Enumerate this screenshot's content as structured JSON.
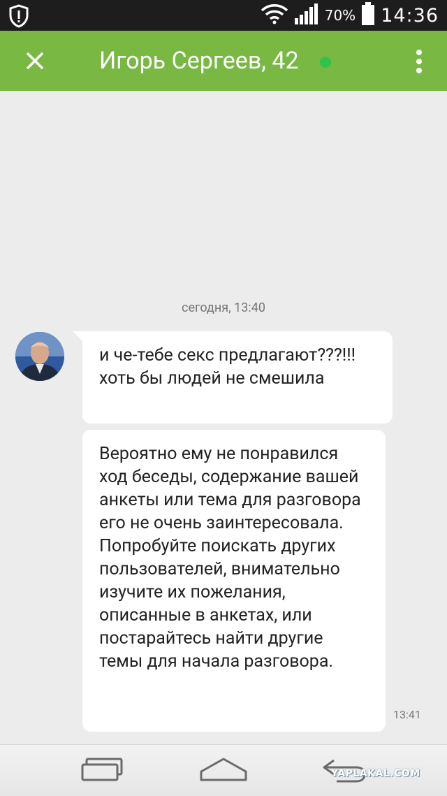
{
  "status_bar": {
    "battery_percent": "70%",
    "time": "14:36",
    "icons": [
      "shield-alert-icon",
      "wifi-icon",
      "signal-icon",
      "battery-icon"
    ]
  },
  "app_bar": {
    "title": "Игорь Сергеев, 42",
    "online": true,
    "accent_color": "#79b843",
    "online_color": "#2fc44a"
  },
  "chat": {
    "date_separator": "сегодня, 13:40",
    "messages": [
      {
        "text": "и че-тебе секс предлагают???!!!хоть бы людей не смешила",
        "time": ""
      },
      {
        "text": "Вероятно ему не понравился ход беседы, содержание вашей анкеты или тема для разговора его не очень заинтересовала. Попробуйте поискать других пользователей, внимательно изучите их пожелания, описанные в анкетах, или постарайтесь найти другие темы для начала разговора.",
        "time": "13:41"
      }
    ]
  },
  "nav_bar": {
    "buttons": [
      "recent-apps-icon",
      "home-icon",
      "back-icon"
    ]
  },
  "watermark": "YAPLAKAL.COM"
}
